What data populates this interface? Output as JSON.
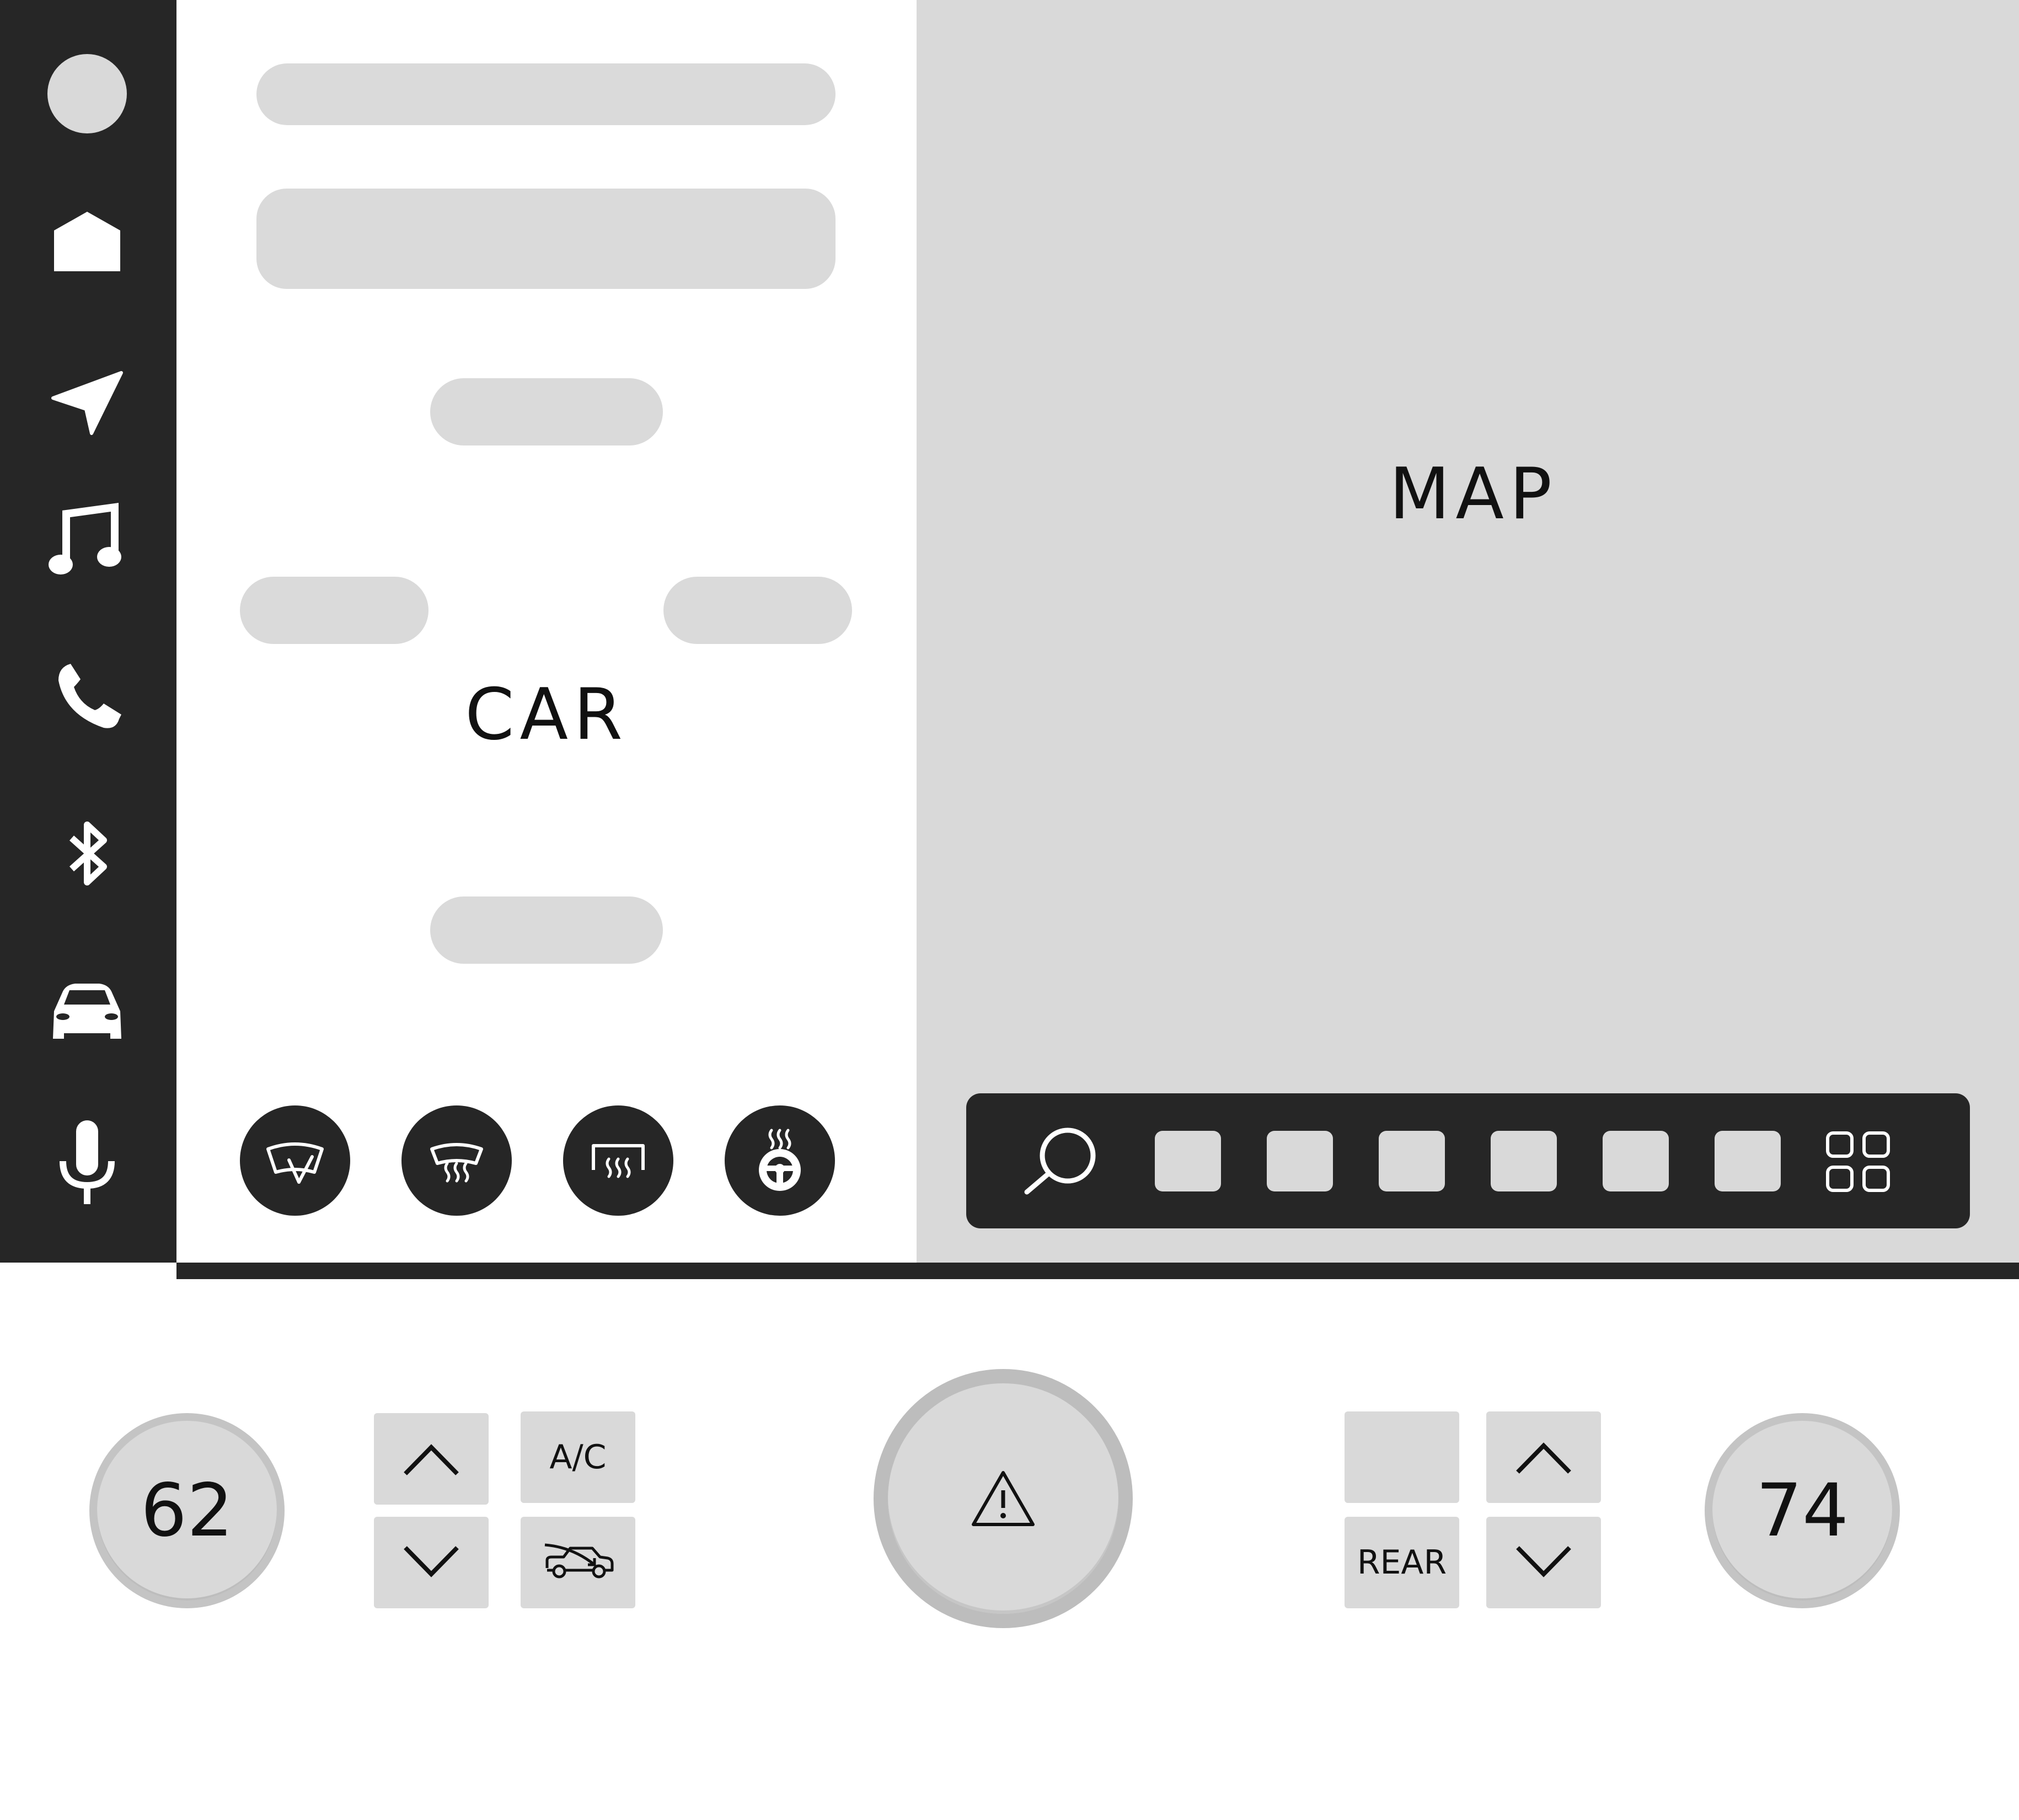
{
  "nav_rail": {
    "items": [
      {
        "name": "profile",
        "icon": "profile-circle-icon"
      },
      {
        "name": "home",
        "icon": "home-icon"
      },
      {
        "name": "navigation",
        "icon": "navigation-arrow-icon"
      },
      {
        "name": "music",
        "icon": "music-note-icon"
      },
      {
        "name": "phone",
        "icon": "phone-icon"
      },
      {
        "name": "bluetooth",
        "icon": "bluetooth-icon"
      },
      {
        "name": "car",
        "icon": "car-front-icon"
      },
      {
        "name": "voice",
        "icon": "microphone-icon"
      }
    ]
  },
  "car_panel": {
    "label": "CAR",
    "quick_controls": [
      {
        "name": "wipers",
        "icon": "windshield-wiper-icon"
      },
      {
        "name": "front_defrost",
        "icon": "front-defrost-icon"
      },
      {
        "name": "rear_defrost",
        "icon": "rear-defrost-icon"
      },
      {
        "name": "heated_steering",
        "icon": "heated-steering-wheel-icon"
      }
    ]
  },
  "map": {
    "label": "MAP",
    "dock": {
      "search_icon": "search-icon",
      "app_slots": 6,
      "apps_icon": "app-grid-icon"
    }
  },
  "climate": {
    "driver_temp": "62",
    "passenger_temp": "74",
    "ac_label": "A/C",
    "rear_label": "REAR",
    "hazard_icon": "hazard-warning-icon",
    "recirculate_icon": "recirculate-car-icon"
  },
  "colors": {
    "dark": "#262626",
    "placeholder": "#dadada",
    "map_bg": "#d9d9d9",
    "white": "#ffffff"
  }
}
